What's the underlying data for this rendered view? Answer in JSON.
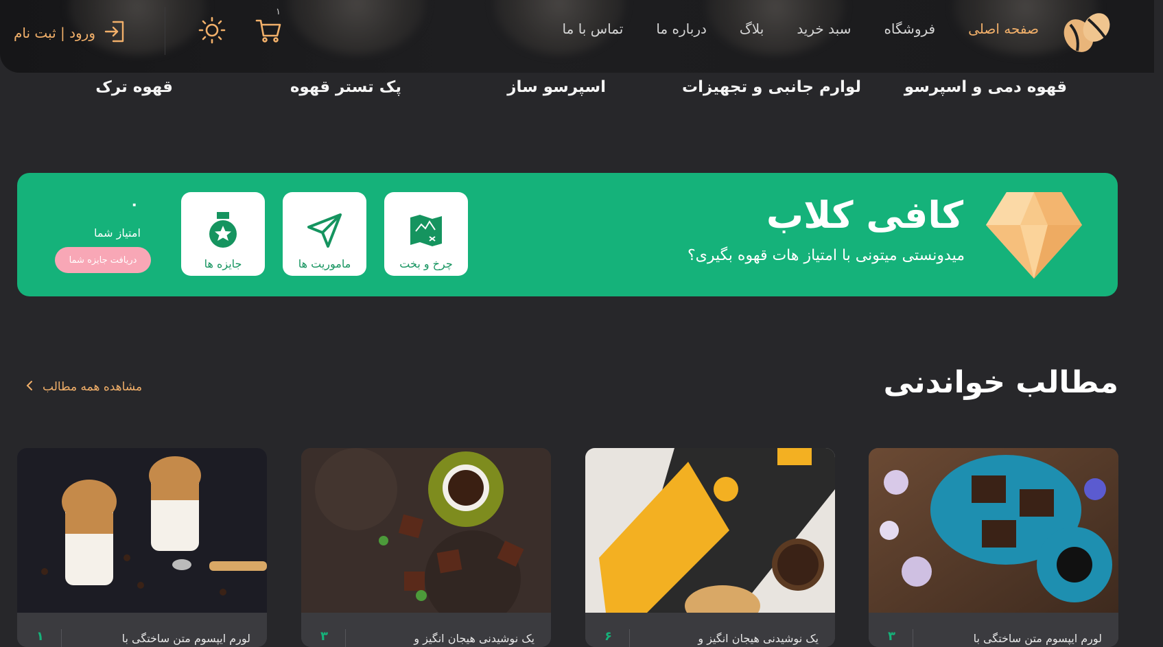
{
  "header": {
    "nav": [
      {
        "label": "صفحه اصلی",
        "active": true
      },
      {
        "label": "فروشگاه",
        "active": false
      },
      {
        "label": "سبد خرید",
        "active": false
      },
      {
        "label": "بلاگ",
        "active": false
      },
      {
        "label": "درباره ما",
        "active": false
      },
      {
        "label": "تماس با ما",
        "active": false
      }
    ],
    "cart_count": "۱",
    "login_label": "ورود | ثبت نام",
    "icons": {
      "logo": "coffee-beans-icon",
      "cart": "cart-icon",
      "theme": "sun-icon",
      "login": "login-icon"
    }
  },
  "categories": [
    "قهوه دمی و اسپرسو",
    "لوارم جانبی و تجهیزات",
    "اسپرسو ساز",
    "پک تستر قهوه",
    "قهوه ترک"
  ],
  "club": {
    "title": "کافی کلاب",
    "subtitle": "میدونستی میتونی با امتیاز هات قهوه بگیری؟",
    "cards": [
      {
        "label": "چرخ و بخت",
        "icon": "map-icon"
      },
      {
        "label": "ماموریت ها",
        "icon": "send-icon"
      },
      {
        "label": "جایزه ها",
        "icon": "medal-icon"
      }
    ],
    "score_value": "۰",
    "score_label": "امتیاز شما",
    "reward_button": "دریافت جایزه شما"
  },
  "articles_section": {
    "title": "مطالب خواندنی",
    "view_all": "مشاهده همه مطالب",
    "items": [
      {
        "number": "۳",
        "title": "لورم ایپسوم متن ساختگی با"
      },
      {
        "number": "۶",
        "title": "یک نوشیدنی هیجان انگیز و"
      },
      {
        "number": "۳",
        "title": "یک نوشیدنی هیجان انگیز و"
      },
      {
        "number": "۱",
        "title": "لورم ایپسوم متن ساختگی با"
      }
    ]
  },
  "colors": {
    "accent": "#f2b06a",
    "green": "#15b27a",
    "bg": "#27272a",
    "pink": "#f8a7b6"
  }
}
